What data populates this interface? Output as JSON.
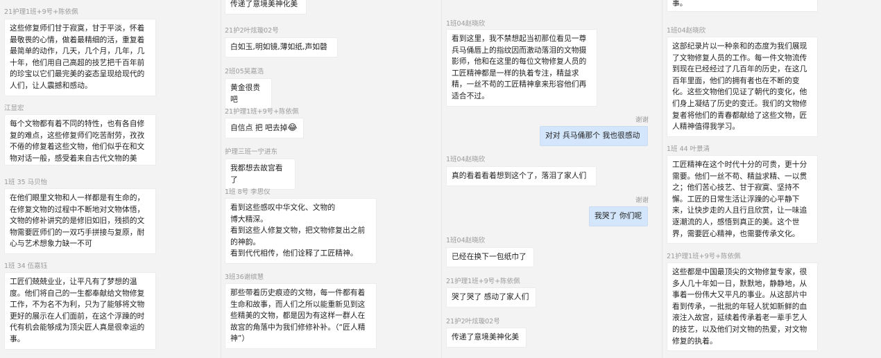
{
  "col1": {
    "m1": {
      "name": "21护理1班+9号+陈依佩",
      "text": "这些修复师们甘于寂寞，甘于平淡，怀着最敬畏的心情，做着最精细的活，重复着最简单的动作，几天，几个月，几年，几十年，他们用自己高超的技艺把千百年前的珍宝以它们最完美的姿态呈现给现代的人们，让人震撼和感动。"
    },
    "m2": {
      "name": "江显宏",
      "text": "每个文物都有着不同的特性，也有各自修复的难点，这些修复师们吃苦耐劳，孜孜不倦的修复着这些文物，他们似乎在和文物对话一般，感受着来自古代文物的美"
    },
    "m3": {
      "name": "1班 35 马贝怡",
      "text": "在他们眼里文物和人一样都是有生命的，在修复文物的过程中不断地对文物体悟，文物的修补讲究的是修旧如旧，残损的文物需要匠师们的一双巧手拼接与复原，耐心与艺术想象力缺一不可"
    },
    "m4": {
      "name": "1班 34 伍嘉钰",
      "text": "工匠们兢兢业业，让平凡有了梦想的温度。他们将自己的一生都奉献给文物修复工作，不为名不为利，只为了能够将文物更好的展示在人们面前，在这个浮躁的时代有机会能够成为顶尖匠人真是很幸运的事。"
    }
  },
  "col2": {
    "m0": {
      "text": "传递了意境美神化美"
    },
    "m1": {
      "name": "21护2叶炫璇02号",
      "text": "白如玉,明如镜,薄如纸,声如磬"
    },
    "m2": {
      "name": "2班05吴嘉浩",
      "text": "黄金很贵吧"
    },
    "m3": {
      "name": "21护理1班+9号+陈依佩",
      "text": "自信点 把 吧去掉",
      "emoji": "😂"
    },
    "m4": {
      "name": "护理三班一宁进东",
      "text": "我都想去故宫看了"
    },
    "m5": {
      "name": "1班 8号 李思仪",
      "text": "看到这些感叹中华文化、文物的\n博大精深。\n看到这些人修复文物，把文物修复出之前的神韵。\n看到代代相传，他们诠释了工匠精神。"
    },
    "m6": {
      "name": "3班36谢缤慧",
      "text": "那些带着历史痕迹的文物，每一件都有着生命和故事，而人们之所以能重新见到这些精美的文物，都是因为有这样一群人在故宫的角落中为我们修修补补。（“匠人精神”）"
    }
  },
  "col3": {
    "m1": {
      "name": "1班04赵晓欣",
      "text": "看到这里，我不禁想起当初那位看见一尊兵马俑唇上的指纹因而激动落泪的文物摄影师，他和在这里的每位文物修复人员的工匠精神都是一样的执着专注，精益求精，一丝不苟的工匠精神拿来形容他们再适合不过。"
    },
    "m2": {
      "name": "谢谢",
      "text": "对对 兵马俑那个 我也很感动"
    },
    "m3": {
      "name": "1班04赵晓欣",
      "text": "真的看着看着想到这个了，落泪了家人们"
    },
    "m4": {
      "name": "谢谢",
      "text": "我哭了 你们呢"
    },
    "m5": {
      "name": "1班04赵晓欣",
      "text": "已经在换下一包纸巾了"
    },
    "m6": {
      "name": "21护理1班+9号+陈依佩",
      "text": "哭了哭了 感动了家人们"
    },
    "m7": {
      "name": "21护2叶炫璇02号",
      "text": "传递了意境美神化美"
    }
  },
  "col4": {
    "m0": {
      "text": "事。"
    },
    "m1": {
      "name": "1班04赵晓欣",
      "text": "这部纪录片以一种亲和的态度为我们展现了文物修复人员的工作。每一件文物流传到现在已经经过了几百年的历史，在这几百年里面，他们的拥有者也在不断的变化。这些文物他们见证了朝代的变化，他们身上凝结了历史的变迁。我们的文物修复者将他们的青春都献给了这些文物，匠人精神值得我学习。"
    },
    "m2": {
      "name": "1班 44 叶景清",
      "text": "工匠精神在这个时代十分的可贵，更十分需要。他们一丝不苟、精益求精、一以贯之；他们苦心技艺、甘于寂寞、坚持不懈。工匠的日常生活让浮躁的心平静下来，让快步走的人且行且欣赏，让一味追逐潮流的人，感悟到真正的美。这个世界，需要匠心精神，也需要传承文化。"
    },
    "m3": {
      "name": "21护理1班+9号+陈依佩",
      "text": "这些都是中国最顶尖的文物修复专家，很多人几十年如一日，默默地，静静地，从事着一份伟大又平凡的事业。从这部片中看到传承，一批批的年轻人犹如新鲜的血液注入故宫，延续着传承着老一辈手艺人的技艺，以及他们对文物的热爱，对文物修复的执着。"
    }
  }
}
